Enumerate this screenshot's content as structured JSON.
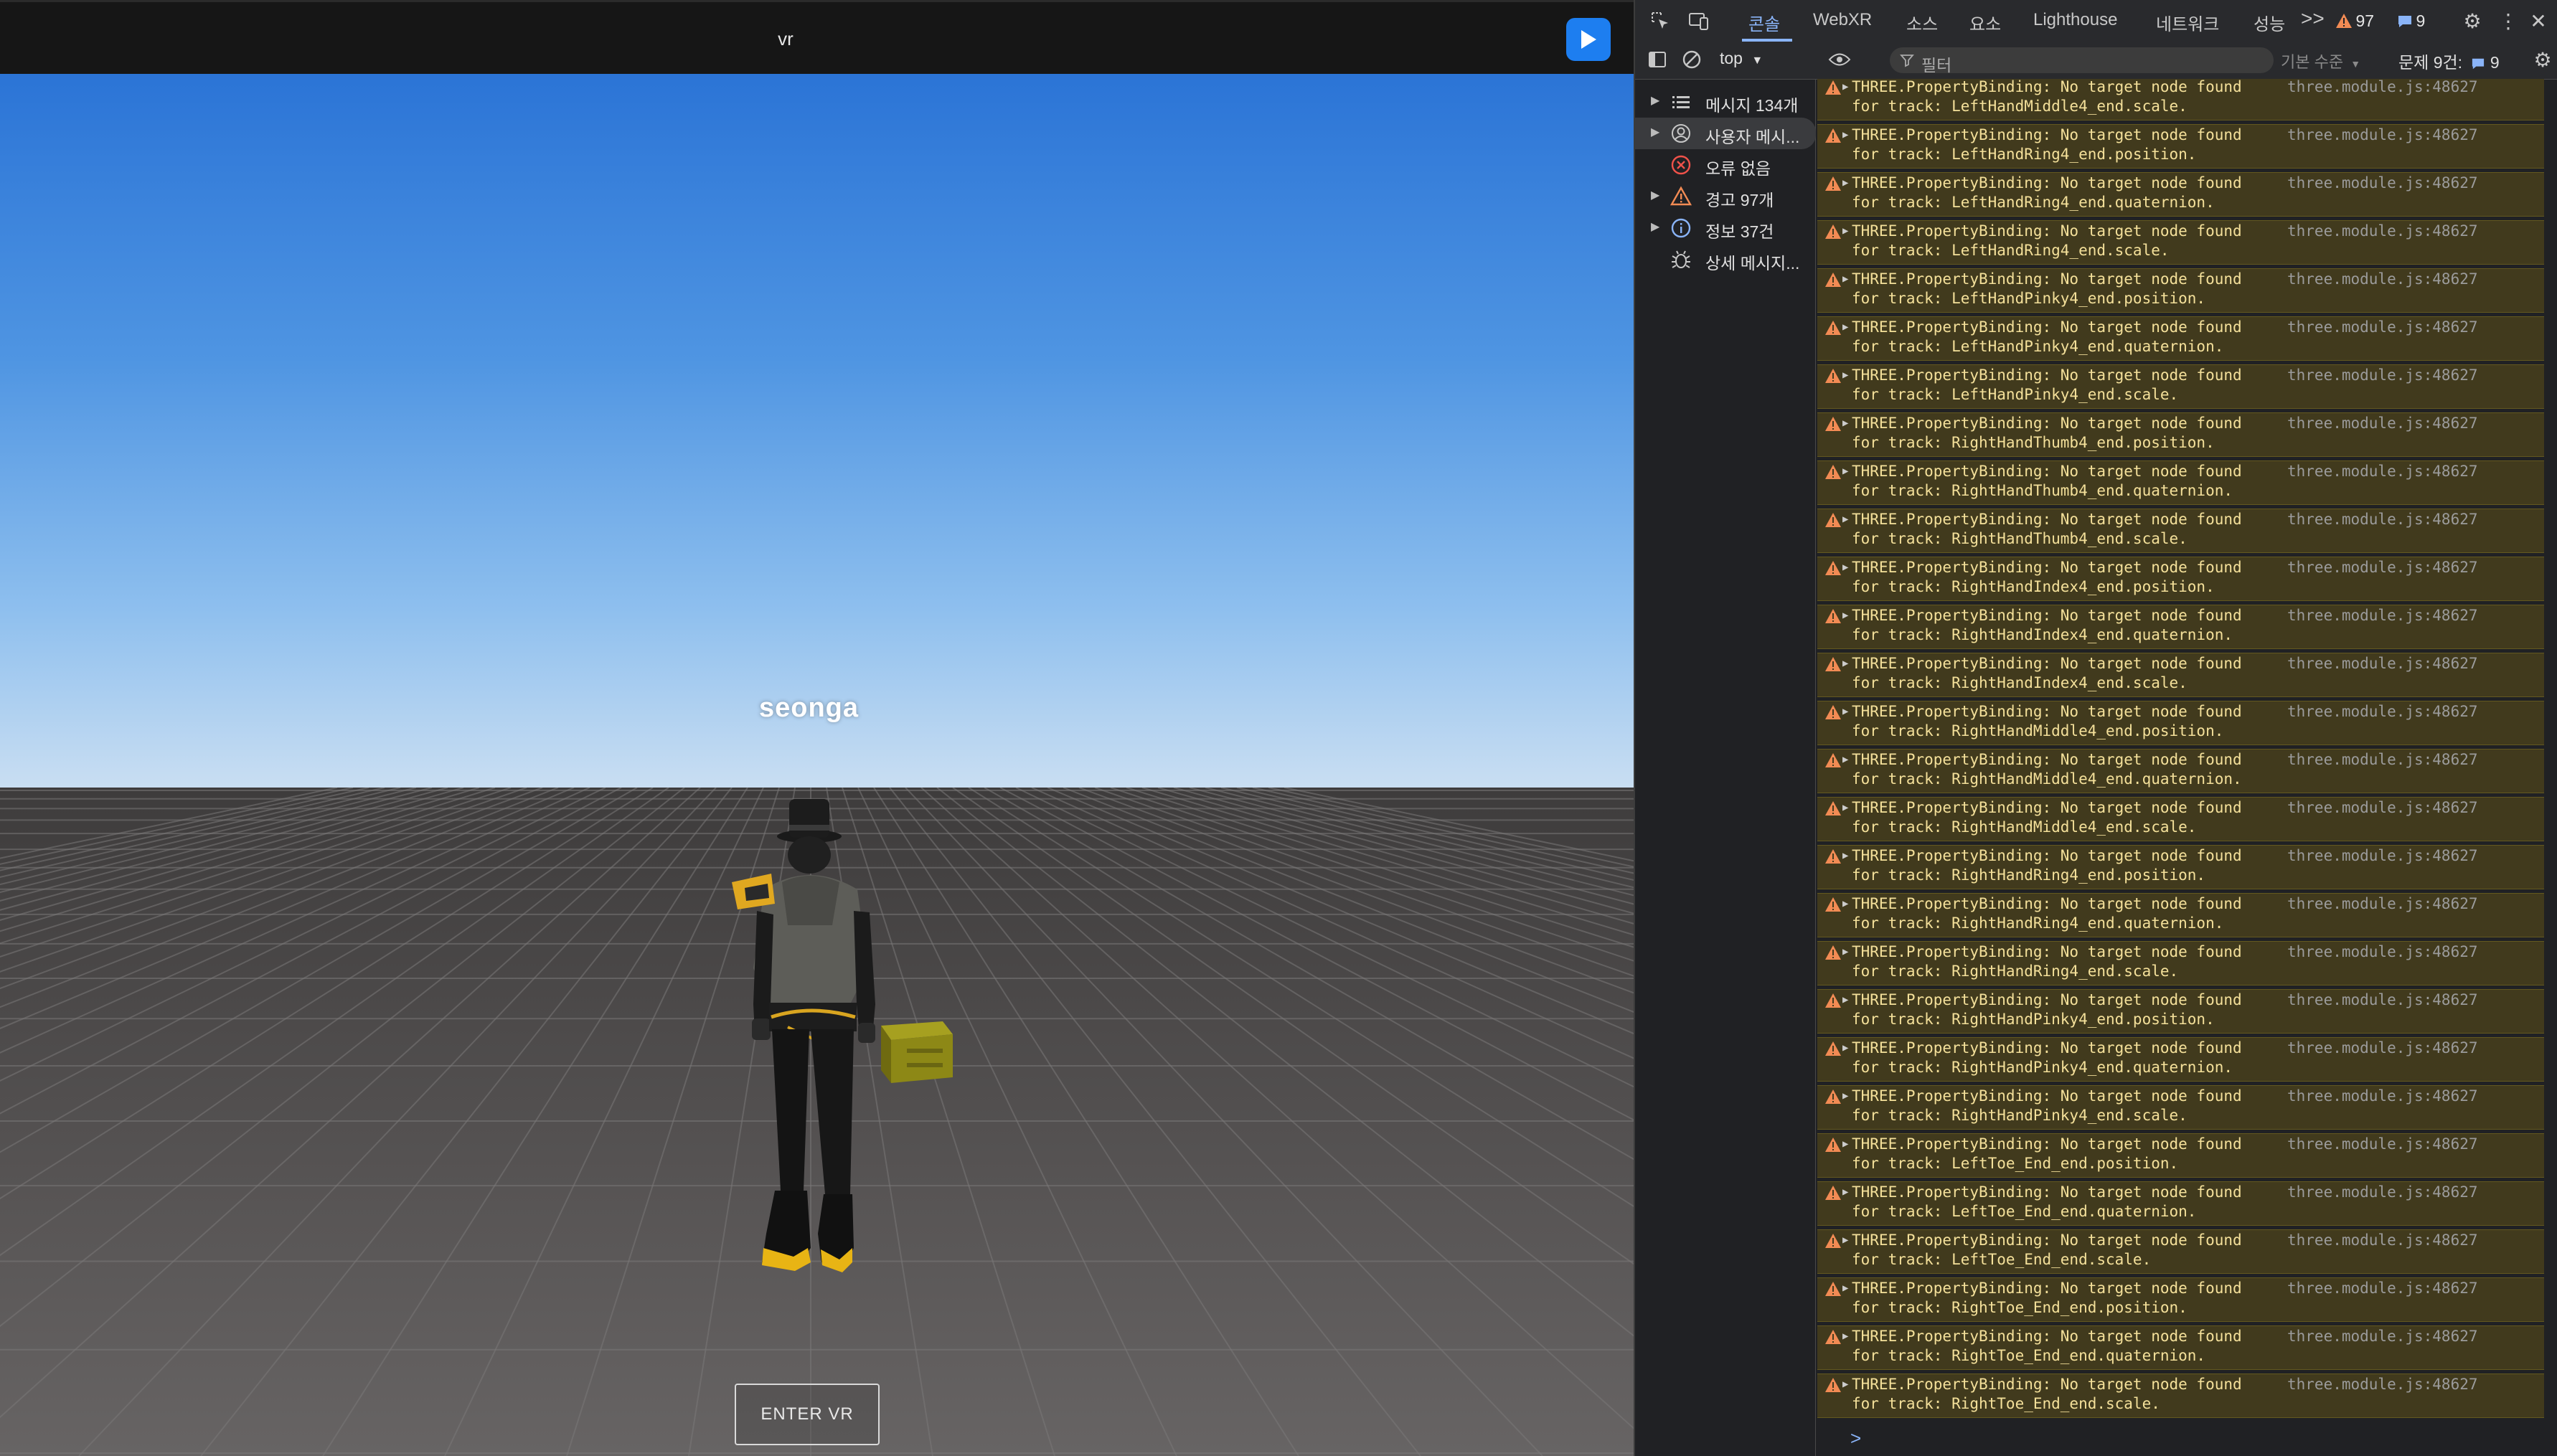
{
  "app": {
    "title": "vr",
    "player_name": "seonga",
    "enter_vr_label": "ENTER VR",
    "play_icon": "play-icon"
  },
  "devtools": {
    "tabs": [
      {
        "label": "콘솔",
        "active": true
      },
      {
        "label": "WebXR",
        "active": false
      },
      {
        "label": "소스",
        "active": false
      },
      {
        "label": "요소",
        "active": false
      },
      {
        "label": "Lighthouse",
        "active": false
      },
      {
        "label": "네트워크",
        "active": false
      },
      {
        "label": "성능",
        "active": false
      }
    ],
    "more_tabs": ">>",
    "warning_count": "97",
    "issue_count": "9",
    "context": "top",
    "filter_placeholder": "필터",
    "level": "기본 수준",
    "issues_label": "문제 9건:",
    "issues_badge": "9",
    "sidebar": [
      {
        "label": "메시지 134개",
        "icon": "list-icon"
      },
      {
        "label": "사용자 메시...",
        "icon": "user-icon",
        "selected": true
      },
      {
        "label": "오류 없음",
        "icon": "error-icon"
      },
      {
        "label": "경고 97개",
        "icon": "warning-icon"
      },
      {
        "label": "정보 37건",
        "icon": "info-icon"
      },
      {
        "label": "상세 메시지...",
        "icon": "bug-icon"
      }
    ],
    "messages": [
      {
        "text": "THREE.PropertyBinding: No target node found",
        "track": "for track: LeftHandMiddle4_end.scale.",
        "source": "three.module.js:48627"
      },
      {
        "text": "THREE.PropertyBinding: No target node found",
        "track": "for track: LeftHandRing4_end.position.",
        "source": "three.module.js:48627"
      },
      {
        "text": "THREE.PropertyBinding: No target node found",
        "track": "for track: LeftHandRing4_end.quaternion.",
        "source": "three.module.js:48627"
      },
      {
        "text": "THREE.PropertyBinding: No target node found",
        "track": "for track: LeftHandRing4_end.scale.",
        "source": "three.module.js:48627"
      },
      {
        "text": "THREE.PropertyBinding: No target node found",
        "track": "for track: LeftHandPinky4_end.position.",
        "source": "three.module.js:48627"
      },
      {
        "text": "THREE.PropertyBinding: No target node found",
        "track": "for track: LeftHandPinky4_end.quaternion.",
        "source": "three.module.js:48627"
      },
      {
        "text": "THREE.PropertyBinding: No target node found",
        "track": "for track: LeftHandPinky4_end.scale.",
        "source": "three.module.js:48627"
      },
      {
        "text": "THREE.PropertyBinding: No target node found",
        "track": "for track: RightHandThumb4_end.position.",
        "source": "three.module.js:48627"
      },
      {
        "text": "THREE.PropertyBinding: No target node found",
        "track": "for track: RightHandThumb4_end.quaternion.",
        "source": "three.module.js:48627"
      },
      {
        "text": "THREE.PropertyBinding: No target node found",
        "track": "for track: RightHandThumb4_end.scale.",
        "source": "three.module.js:48627"
      },
      {
        "text": "THREE.PropertyBinding: No target node found",
        "track": "for track: RightHandIndex4_end.position.",
        "source": "three.module.js:48627"
      },
      {
        "text": "THREE.PropertyBinding: No target node found",
        "track": "for track: RightHandIndex4_end.quaternion.",
        "source": "three.module.js:48627"
      },
      {
        "text": "THREE.PropertyBinding: No target node found",
        "track": "for track: RightHandIndex4_end.scale.",
        "source": "three.module.js:48627"
      },
      {
        "text": "THREE.PropertyBinding: No target node found",
        "track": "for track: RightHandMiddle4_end.position.",
        "source": "three.module.js:48627"
      },
      {
        "text": "THREE.PropertyBinding: No target node found",
        "track": "for track: RightHandMiddle4_end.quaternion.",
        "source": "three.module.js:48627"
      },
      {
        "text": "THREE.PropertyBinding: No target node found",
        "track": "for track: RightHandMiddle4_end.scale.",
        "source": "three.module.js:48627"
      },
      {
        "text": "THREE.PropertyBinding: No target node found",
        "track": "for track: RightHandRing4_end.position.",
        "source": "three.module.js:48627"
      },
      {
        "text": "THREE.PropertyBinding: No target node found",
        "track": "for track: RightHandRing4_end.quaternion.",
        "source": "three.module.js:48627"
      },
      {
        "text": "THREE.PropertyBinding: No target node found",
        "track": "for track: RightHandRing4_end.scale.",
        "source": "three.module.js:48627"
      },
      {
        "text": "THREE.PropertyBinding: No target node found",
        "track": "for track: RightHandPinky4_end.position.",
        "source": "three.module.js:48627"
      },
      {
        "text": "THREE.PropertyBinding: No target node found",
        "track": "for track: RightHandPinky4_end.quaternion.",
        "source": "three.module.js:48627"
      },
      {
        "text": "THREE.PropertyBinding: No target node found",
        "track": "for track: RightHandPinky4_end.scale.",
        "source": "three.module.js:48627"
      },
      {
        "text": "THREE.PropertyBinding: No target node found",
        "track": "for track: LeftToe_End_end.position.",
        "source": "three.module.js:48627"
      },
      {
        "text": "THREE.PropertyBinding: No target node found",
        "track": "for track: LeftToe_End_end.quaternion.",
        "source": "three.module.js:48627"
      },
      {
        "text": "THREE.PropertyBinding: No target node found",
        "track": "for track: LeftToe_End_end.scale.",
        "source": "three.module.js:48627"
      },
      {
        "text": "THREE.PropertyBinding: No target node found",
        "track": "for track: RightToe_End_end.position.",
        "source": "three.module.js:48627"
      },
      {
        "text": "THREE.PropertyBinding: No target node found",
        "track": "for track: RightToe_End_end.quaternion.",
        "source": "three.module.js:48627"
      },
      {
        "text": "THREE.PropertyBinding: No target node found",
        "track": "for track: RightToe_End_end.scale.",
        "source": "three.module.js:48627"
      }
    ],
    "prompt": ">"
  },
  "colors": {
    "accent": "#8ab4f8",
    "warning_bg": "#413a1d",
    "warning_text": "#f4e09a",
    "play_button": "#1d7ef0"
  }
}
